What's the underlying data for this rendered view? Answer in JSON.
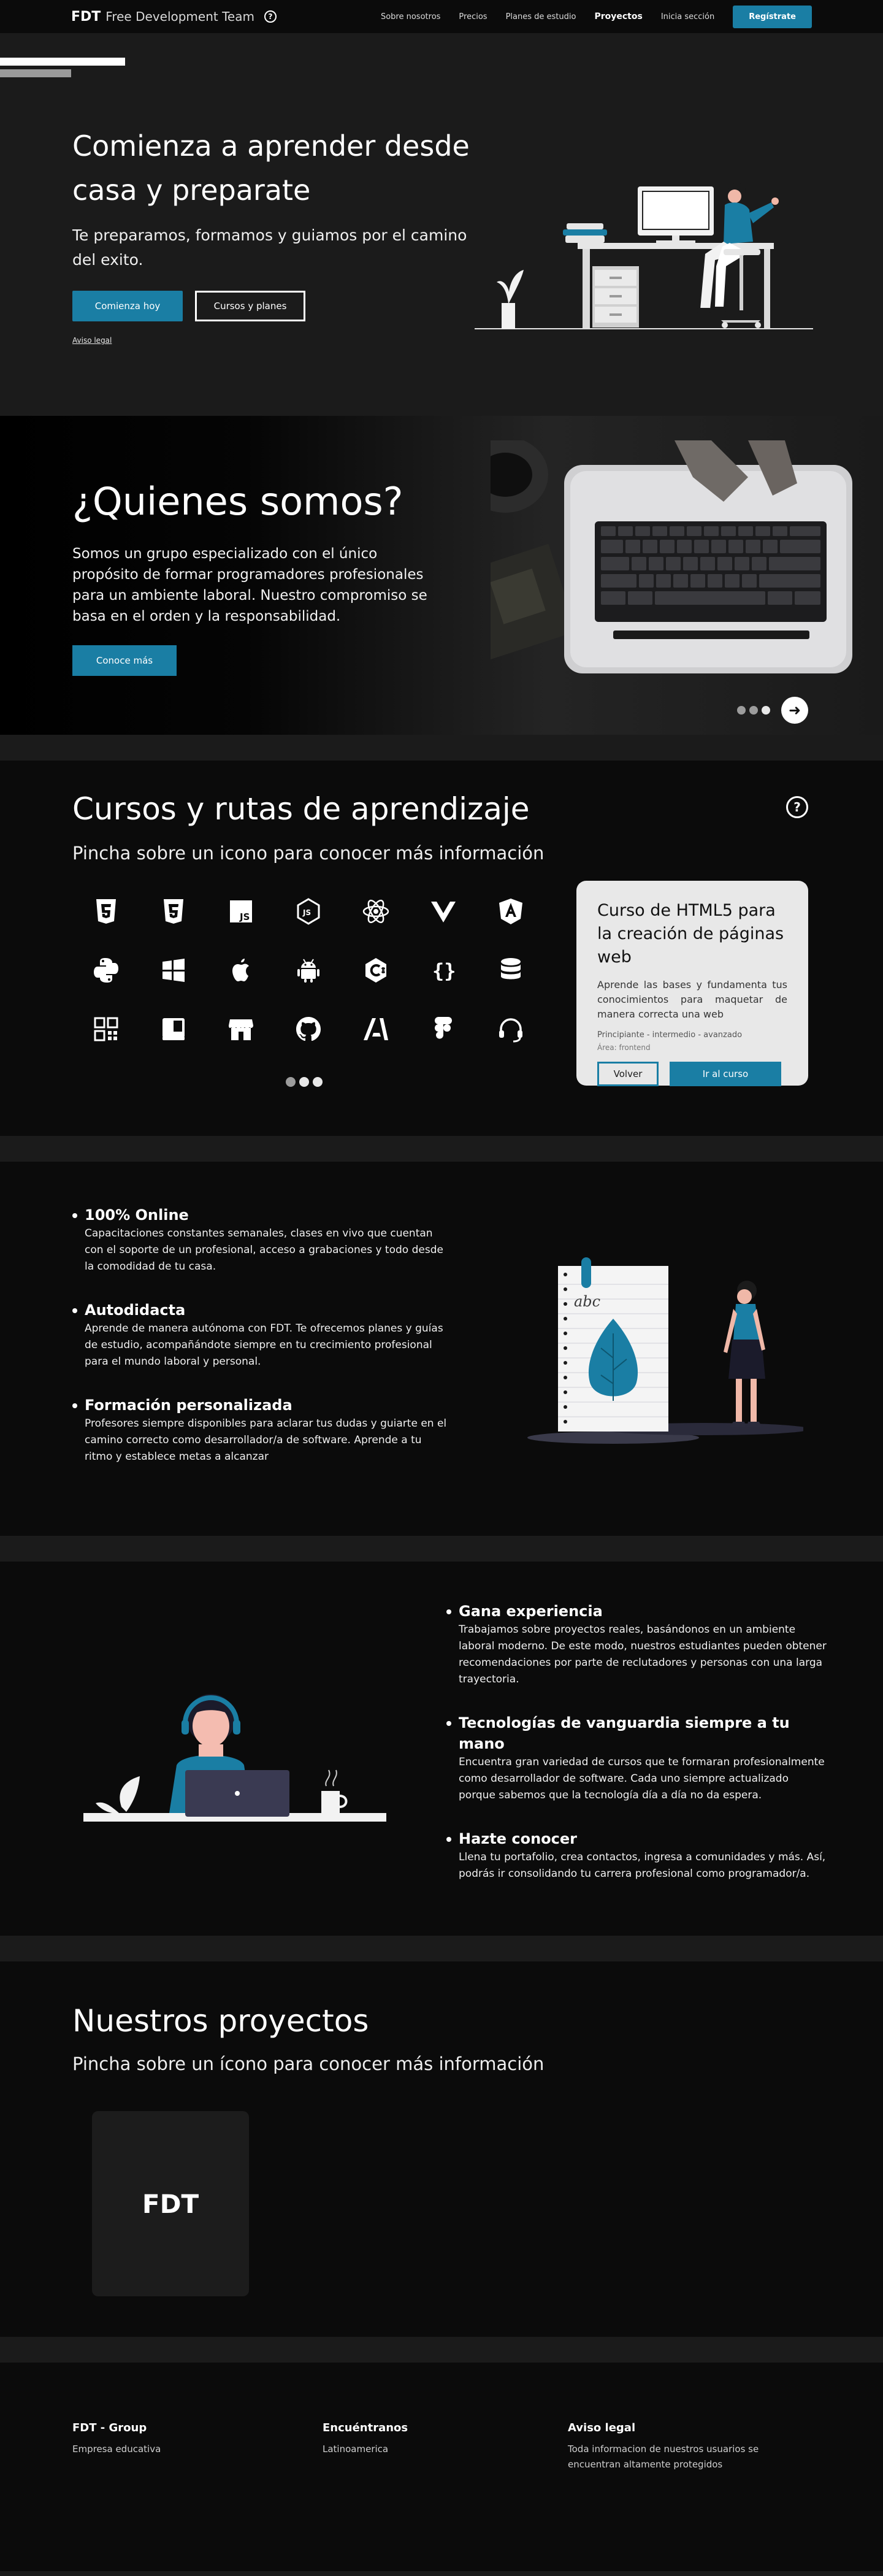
{
  "nav": {
    "brand_short": "FDT",
    "brand_name": "Free Development Team",
    "help_glyph": "?",
    "links": [
      "Sobre nosotros",
      "Precios",
      "Planes de estudio",
      "Proyectos",
      "Inicia sección"
    ],
    "active_link": "Proyectos",
    "cta": "Regístrate"
  },
  "hero": {
    "title": "Comienza a aprender desde casa y preparate",
    "subtitle": "Te preparamos, formamos y guiamos por el camino del exito.",
    "primary_button": "Comienza hoy",
    "secondary_button": "Cursos y planes",
    "legal_link": "Aviso legal"
  },
  "about": {
    "title": "¿Quienes somos?",
    "description": "Somos un grupo especializado con el único propósito de formar programadores profesionales para un ambiente laboral. Nuestro compromiso se basa en el orden y la responsabilidad.",
    "button": "Conoce más",
    "carousel_active_index": 2,
    "next_glyph": "➜"
  },
  "courses": {
    "title": "Cursos y rutas de aprendizaje",
    "subtitle": "Pincha sobre un icono para conocer más información",
    "help_glyph": "?",
    "icons": [
      "html5-icon",
      "css3-icon",
      "javascript-icon",
      "nodejs-icon",
      "react-icon",
      "vue-icon",
      "angular-icon",
      "python-icon",
      "windows-icon",
      "apple-icon",
      "android-icon",
      "csharp-icon",
      "json-braces-icon",
      "database-icon",
      "apps-grid-icon",
      "book-icon",
      "store-icon",
      "github-icon",
      "adobe-icon",
      "figma-icon",
      "headset-icon"
    ],
    "grid_page_active_index": 1,
    "card": {
      "title": "Curso de HTML5 para la creación de páginas web",
      "description": "Aprende las bases y fundamenta tus conocimientos para maquetar de manera correcta una web",
      "levels": "Principiante - intermedio - avanzado",
      "area": "Área: frontend",
      "back_button": "Volver",
      "go_button": "Ir al curso"
    }
  },
  "features": {
    "items": [
      {
        "title": "100% Online",
        "text": "Capacitaciones constantes semanales, clases en vivo que cuentan con el soporte de un profesional, acceso a grabaciones y todo desde la comodidad de tu casa."
      },
      {
        "title": "Autodidacta",
        "text": "Aprende de manera autónoma con FDT. Te ofrecemos planes y guías de estudio, acompañándote siempre en tu crecimiento profesional para el mundo laboral y personal."
      },
      {
        "title": "Formación personalizada",
        "text": "Profesores siempre disponibles para aclarar tus dudas y guiarte en el camino correcto como desarrollador/a de software. Aprende a tu ritmo y establece metas a alcanzar"
      }
    ],
    "notebook_text": "abc"
  },
  "experience": {
    "items": [
      {
        "title": "Gana experiencia",
        "text": "Trabajamos sobre proyectos reales, basándonos en un ambiente laboral moderno. De este modo, nuestros estudiantes pueden obtener recomendaciones por parte de reclutadores y personas con una larga trayectoria."
      },
      {
        "title": "Tecnologías de vanguardia siempre a tu mano",
        "text": "Encuentra gran variedad de cursos que te formaran profesionalmente como desarrollador de software. Cada uno siempre actualizado porque sabemos que la tecnología día a día no da espera."
      },
      {
        "title": "Hazte conocer",
        "text": "Llena tu portafolio, crea contactos, ingresa a comunidades y más. Así, podrás ir consolidando tu carrera profesional como programador/a."
      }
    ]
  },
  "projects": {
    "title": "Nuestros proyectos",
    "subtitle": "Pincha sobre un ícono para conocer más información",
    "card_label": "FDT"
  },
  "footer": {
    "columns": [
      {
        "title": "FDT - Group",
        "text": "Empresa educativa"
      },
      {
        "title": "Encuéntranos",
        "text": "Latinoamerica"
      },
      {
        "title": "Aviso legal",
        "text": "Toda informacion de nuestros usuarios se encuentran altamente protegidos"
      }
    ]
  },
  "colors": {
    "accent": "#1a7ea4",
    "background": "#0b0b0b",
    "hero_background": "#1b1b1b",
    "card_background": "#e8e8e8"
  }
}
